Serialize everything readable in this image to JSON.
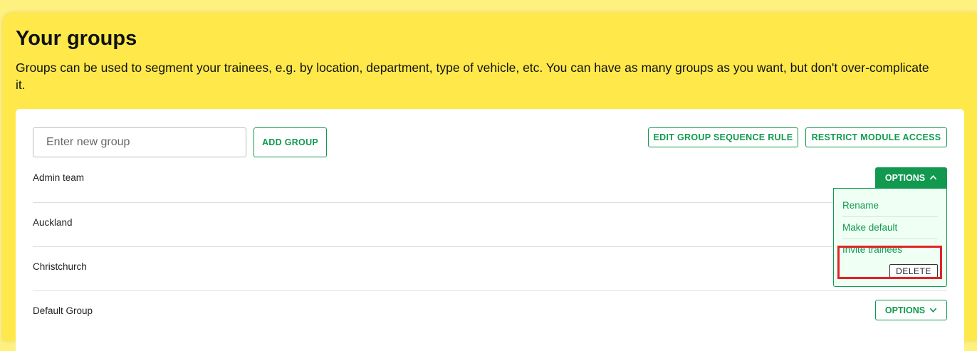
{
  "page": {
    "title": "Your groups",
    "description": "Groups can be used to segment your trainees, e.g. by location, department, type of vehicle, etc. You can have as many groups as you want, but don't over-complicate it."
  },
  "toolbar": {
    "new_group_placeholder": "Enter new group",
    "add_group_label": "ADD GROUP",
    "edit_sequence_label": "EDIT GROUP SEQUENCE RULE",
    "restrict_access_label": "RESTRICT MODULE ACCESS"
  },
  "groups": [
    {
      "name": "Admin team"
    },
    {
      "name": "Auckland"
    },
    {
      "name": "Christchurch"
    },
    {
      "name": "Default Group"
    }
  ],
  "options": {
    "label": "OPTIONS",
    "menu": {
      "rename": "Rename",
      "make_default": "Make default",
      "invite": "Invite trainees",
      "delete": "DELETE"
    }
  },
  "colors": {
    "accent": "#0f9a4f",
    "background": "#ffe94a",
    "highlight": "#e02424"
  }
}
